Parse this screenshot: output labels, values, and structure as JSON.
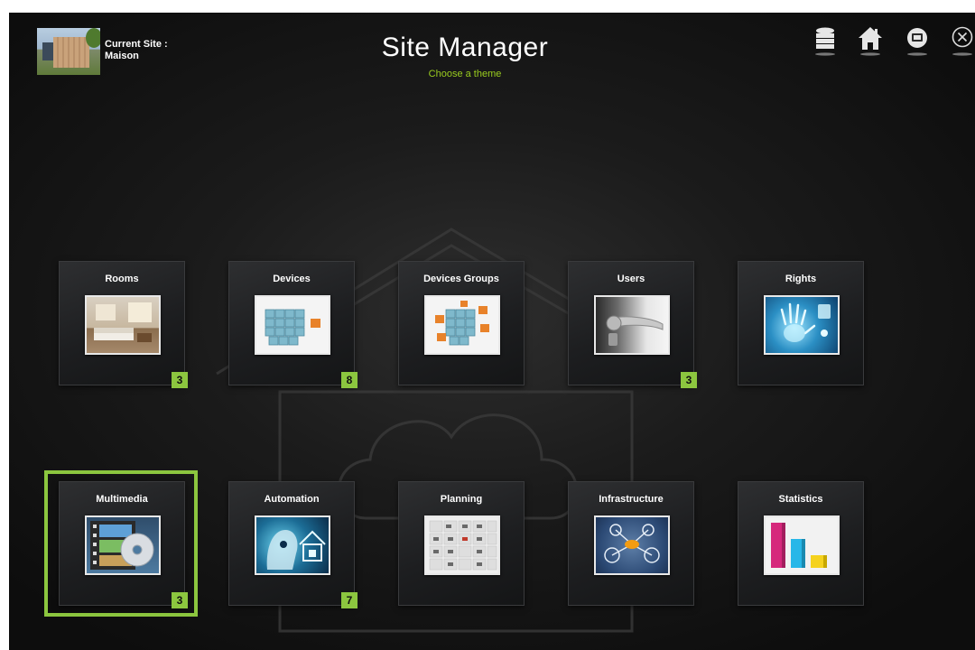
{
  "header": {
    "current_site_label": "Current Site :",
    "current_site_name": "Maison",
    "title": "Site Manager",
    "subtitle": "Choose a theme"
  },
  "toolbar_icons": [
    "database-icon",
    "home-icon",
    "display-icon",
    "close-icon"
  ],
  "colors": {
    "accent": "#8cc63f",
    "subtitle": "#9acd1f",
    "background": "#1b1b1b"
  },
  "tiles": [
    {
      "label": "Rooms",
      "badge": "3",
      "icon": "living-room-icon"
    },
    {
      "label": "Devices",
      "badge": "8",
      "icon": "cubes-icon"
    },
    {
      "label": "Devices Groups",
      "badge": "",
      "icon": "cubes-group-icon"
    },
    {
      "label": "Users",
      "badge": "3",
      "icon": "door-handle-icon"
    },
    {
      "label": "Rights",
      "badge": "",
      "icon": "hand-scan-icon"
    },
    {
      "label": "Multimedia",
      "badge": "3",
      "icon": "film-disc-icon",
      "selected": true
    },
    {
      "label": "Automation",
      "badge": "7",
      "icon": "robot-home-icon"
    },
    {
      "label": "Planning",
      "badge": "",
      "icon": "calendar-icon"
    },
    {
      "label": "Infrastructure",
      "badge": "",
      "icon": "network-nodes-icon"
    },
    {
      "label": "Statistics",
      "badge": "",
      "icon": "bar-chart-icon"
    }
  ]
}
